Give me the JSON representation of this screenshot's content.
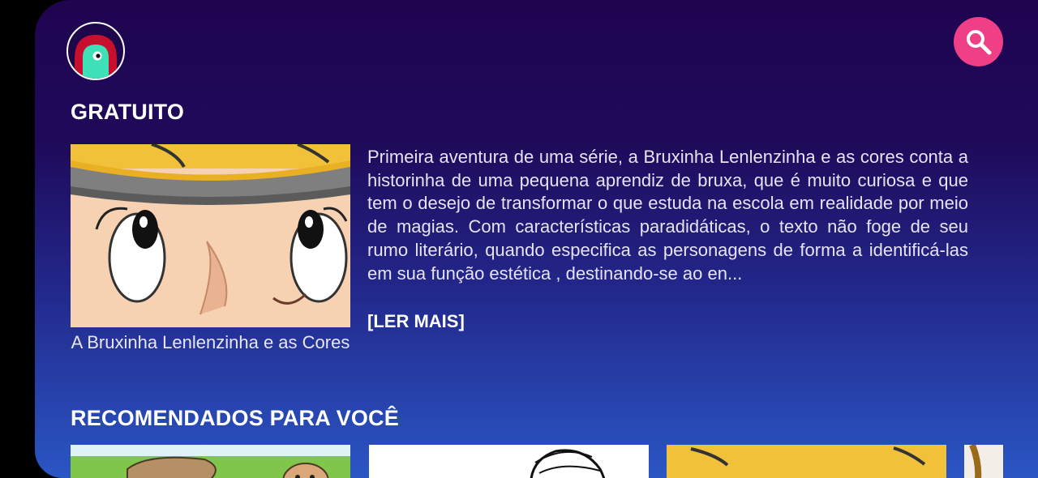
{
  "header": {
    "avatar_icon": "monster-avatar-icon",
    "search_icon": "search-icon"
  },
  "free_section": {
    "title": "GRATUITO",
    "book": {
      "title": "A Bruxinha Lenlenzinha e as Cores",
      "description": "Primeira aventura de uma série, a Bruxinha Lenlenzinha e as cores conta a historinha de uma pequena aprendiz de bruxa, que é muito curiosa e que tem o desejo de transformar o que estuda na escola em realidade por meio de magias. Com características paradidáticas, o texto não foge de seu rumo literário, quando especifica as personagens de forma a identificá-las em sua função estética , destinando-se ao en...",
      "read_more": "[LER MAIS]"
    }
  },
  "recommended_section": {
    "title": "RECOMENDADOS PARA VOCÊ"
  },
  "colors": {
    "accent": "#ef3f86",
    "background_top": "#1f0450",
    "background_bottom": "#2a56c4"
  }
}
